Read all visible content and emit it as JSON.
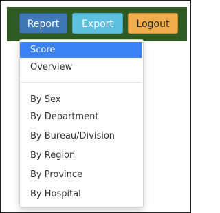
{
  "toolbar": {
    "report_label": "Report",
    "export_label": "Export",
    "logout_label": "Logout"
  },
  "report_menu": {
    "items": [
      {
        "label": "Score",
        "active": true
      },
      {
        "label": "Overview"
      },
      {
        "label": "By Sex"
      },
      {
        "label": "By Department"
      },
      {
        "label": "By Bureau/Division"
      },
      {
        "label": "By Region"
      },
      {
        "label": "By Province"
      },
      {
        "label": "By Hospital"
      }
    ]
  },
  "colors": {
    "header_bg": "#2f5a23",
    "report_btn": "#3f78b5",
    "export_btn": "#5cc0de",
    "logout_btn": "#f0ad4e",
    "active_item_bg": "#3b82f6"
  }
}
